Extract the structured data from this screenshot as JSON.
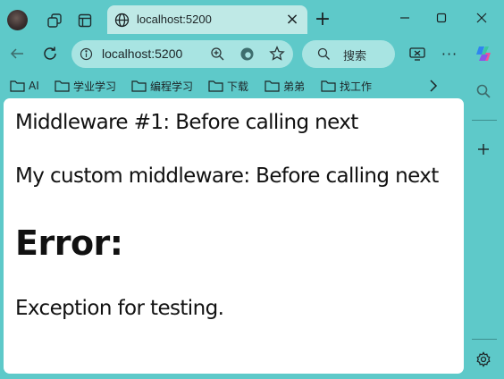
{
  "browser": {
    "tab": {
      "title": "localhost:5200"
    },
    "address_bar": {
      "url": "localhost:5200"
    },
    "search": {
      "label": "搜索"
    },
    "bookmarks": [
      {
        "label": "AI"
      },
      {
        "label": "学业学习"
      },
      {
        "label": "编程学习"
      },
      {
        "label": "下载"
      },
      {
        "label": "弟弟"
      },
      {
        "label": "找工作"
      }
    ]
  },
  "page": {
    "line1": "Middleware #1: Before calling next",
    "line2": "My custom middleware: Before calling next",
    "error_heading": "Error:",
    "error_message": "Exception for testing."
  },
  "colors": {
    "frame": "#5ec9c9",
    "tab_active": "#bfe9e6",
    "address_bar": "#a8e4e2",
    "page_bg": "#ffffff"
  }
}
